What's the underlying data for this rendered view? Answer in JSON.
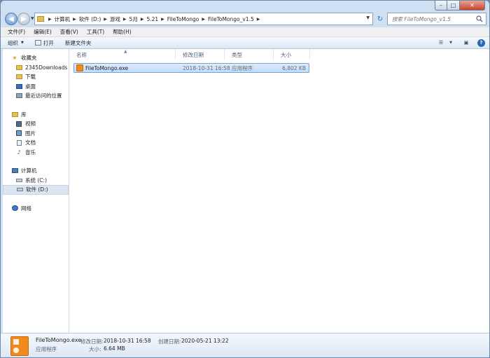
{
  "window": {
    "caption": {
      "minimize": "–",
      "maximize": "□",
      "close": "✕"
    }
  },
  "address": {
    "crumbs": [
      "计算机",
      "软件 (D:)",
      "游戏",
      "5月",
      "5.21",
      "FileToMongo",
      "FileToMongo_v1.5"
    ],
    "search_placeholder": "搜索 FileToMongo_v1.5"
  },
  "menu": [
    "文件(F)",
    "编辑(E)",
    "查看(V)",
    "工具(T)",
    "帮助(H)"
  ],
  "commands": {
    "organize": "组织",
    "open": "打开",
    "new_folder": "新建文件夹"
  },
  "nav": {
    "favorites": {
      "label": "收藏夹",
      "items": [
        "2345Downloads",
        "下载",
        "桌面",
        "最近访问的位置"
      ]
    },
    "libraries": {
      "label": "库",
      "items": [
        "视频",
        "图片",
        "文档",
        "音乐"
      ]
    },
    "computer": {
      "label": "计算机",
      "items": [
        "系统 (C:)",
        "软件 (D:)"
      ]
    },
    "network": {
      "label": "网络"
    }
  },
  "columns": {
    "name": "名称",
    "modified": "修改日期",
    "type": "类型",
    "size": "大小"
  },
  "files": [
    {
      "name": "FileToMongo.exe",
      "modified": "2018-10-31 16:58",
      "type": "应用程序",
      "size": "6,802 KB"
    }
  ],
  "details": {
    "name": "FileToMongo.exe",
    "type": "应用程序",
    "modified_label": "修改日期:",
    "modified": "2018-10-31 16:58",
    "created_label": "创建日期:",
    "created": "2020-05-21 13:22",
    "size_label": "大小:",
    "size": "6.64 MB"
  }
}
